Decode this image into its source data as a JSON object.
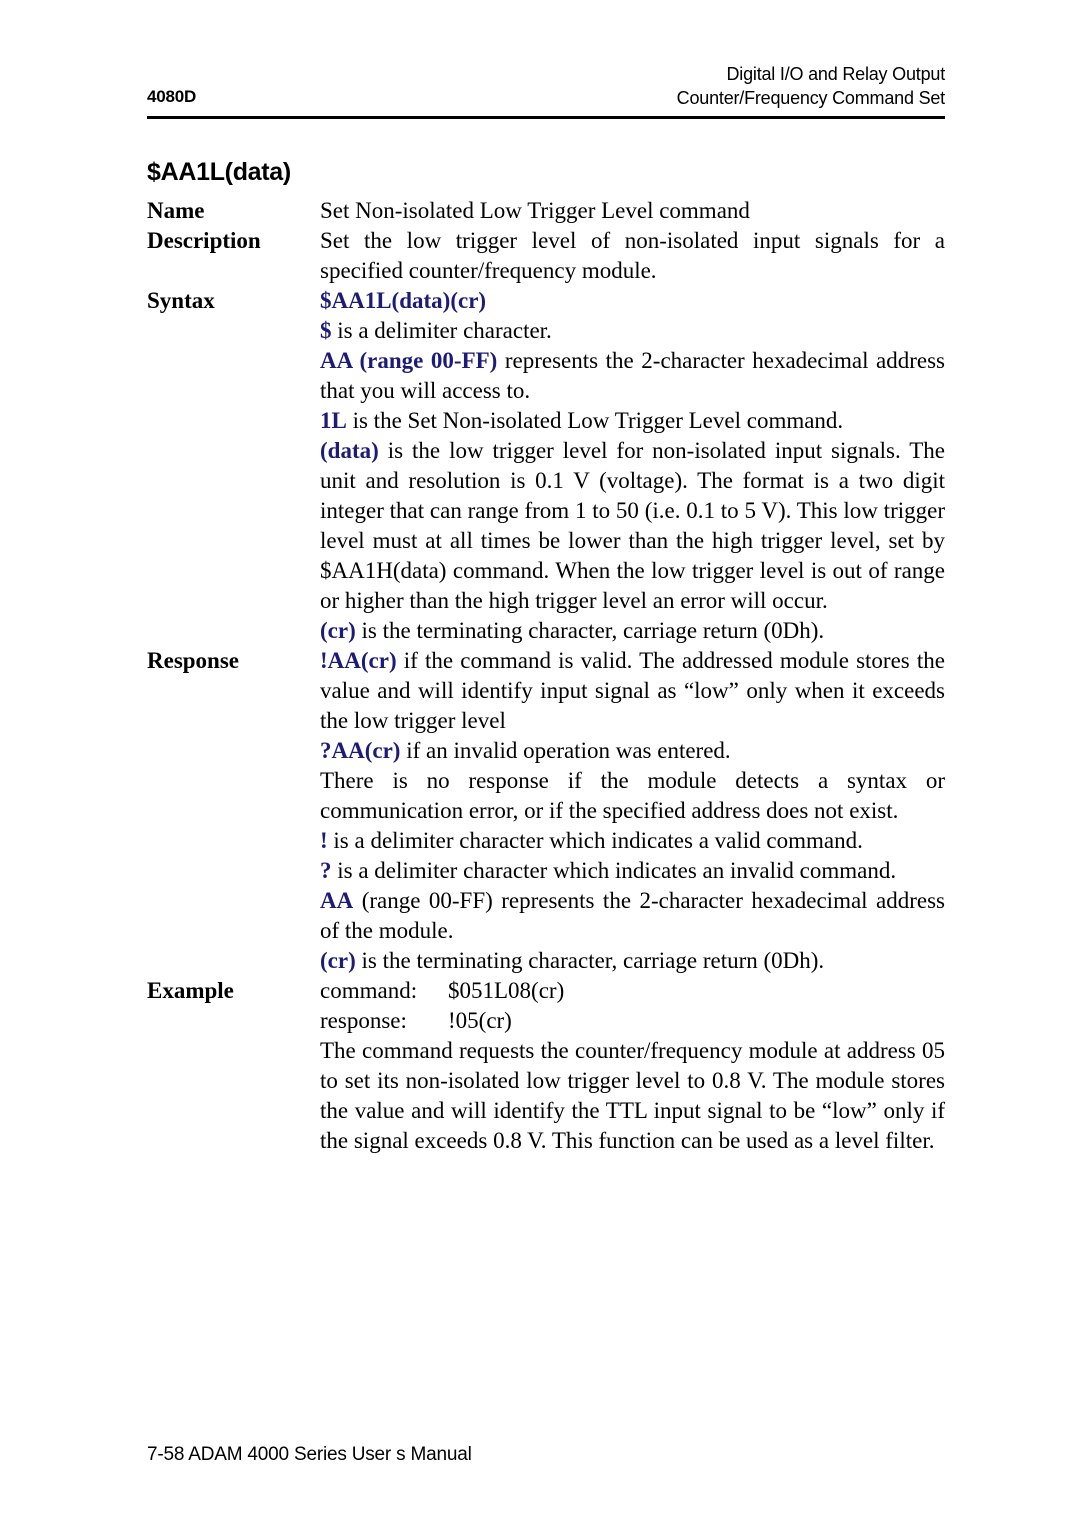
{
  "header": {
    "left": "4080D",
    "right_line1": "Digital I/O and Relay Output",
    "right_line2": "Counter/Frequency Command Set"
  },
  "heading": "$AA1L(data)",
  "labels": {
    "name": "Name",
    "description": "Description",
    "syntax": "Syntax",
    "response": "Response",
    "example": "Example"
  },
  "name": {
    "text": "Set Non-isolated Low Trigger Level command"
  },
  "description": {
    "text": "Set the low trigger level of non-isolated input signals for a specified counter/frequency module."
  },
  "syntax": {
    "command": "$AA1L(data)(cr)",
    "delimiter_token": "$",
    "delimiter_text": " is a delimiter character.",
    "address_token": "AA (range 00-FF)",
    "address_text": " represents the 2-character hexadecimal address that you will access to.",
    "cmd_token": "1L",
    "cmd_text": " is the Set Non-isolated Low Trigger Level command.",
    "data_token": "(data)",
    "data_text": " is the low trigger level for non-isolated input signals. The unit and resolution is 0.1 V (voltage). The format is a two digit integer that can range from 1 to 50 (i.e. 0.1 to 5 V). This low trigger level must at all times be lower than the high trigger level, set by $AA1H(data) command. When the low trigger level is out of range or higher than the high trigger level an error will occur.",
    "cr_token": "(cr)",
    "cr_text": " is the terminating character, carriage return (0Dh)."
  },
  "response": {
    "valid_token": "!AA(cr)",
    "valid_text": " if the command is valid. The addressed module stores the value and will identify input signal as “low” only when it exceeds the low trigger level",
    "invalid_token": "?AA(cr)",
    "invalid_text": " if an invalid operation was entered.",
    "noresp_text": "There is no response if the module detects a syntax or communication error, or if the specified address does not exist.",
    "bang_token": "!",
    "bang_text": " is a delimiter character which indicates a valid command.",
    "question_token": "?",
    "question_text": " is a delimiter character which indicates an invalid command.",
    "aa_token": "AA",
    "aa_text": " (range 00-FF) represents the 2-character hexadecimal address of the module.",
    "cr_token": "(cr)",
    "cr_text": " is the terminating character, carriage return (0Dh)."
  },
  "example": {
    "command_key": "command:",
    "command_val": "$051L08(cr)",
    "response_key": "response:",
    "response_val": "!05(cr)",
    "explanation": "The command requests the counter/frequency module at address 05 to set its non-isolated low trigger level to 0.8 V. The module stores the value and will identify the TTL input signal to be “low” only if the signal exceeds 0.8 V. This function can be used as a level filter."
  },
  "footer": {
    "text": "7-58 ADAM 4000 Series User s Manual"
  },
  "colors": {
    "token_blue": "#1c1c78",
    "text_black": "#000000",
    "page_background": "#ffffff"
  }
}
